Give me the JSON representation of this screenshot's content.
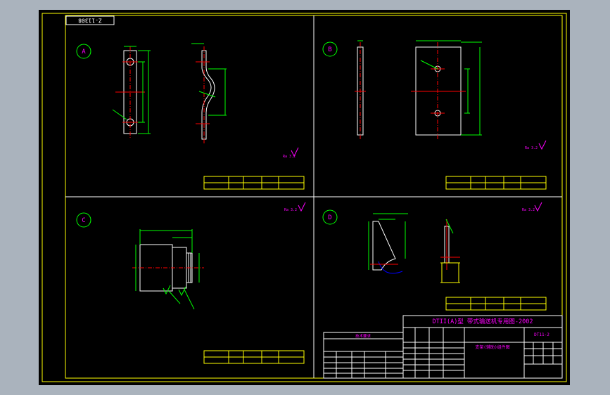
{
  "drawing_number": "Z-11308",
  "views": {
    "a": {
      "label": "A",
      "roughness_symbol": "Ra 3.2"
    },
    "b": {
      "label": "B",
      "roughness_symbol": "Ra 3.2"
    },
    "c": {
      "label": "C",
      "roughness_symbol": "Ra 3.2"
    },
    "d": {
      "label": "D",
      "roughness_symbol": "Ra 3.2"
    }
  },
  "title_block": {
    "project_title": "DTII(A)型 带式输送机专用图-2002",
    "drawing_code": "DT11-2",
    "part_name": "支架(辅助)组件图",
    "note_header": "技术要求"
  },
  "colors": {
    "background": "#000000",
    "frame": "#ffff00",
    "geometry": "#ffffff",
    "dimension": "#00ff00",
    "centerline": "#ff0000",
    "annotation": "#ff00ff",
    "viewport": "#aab3bd"
  }
}
